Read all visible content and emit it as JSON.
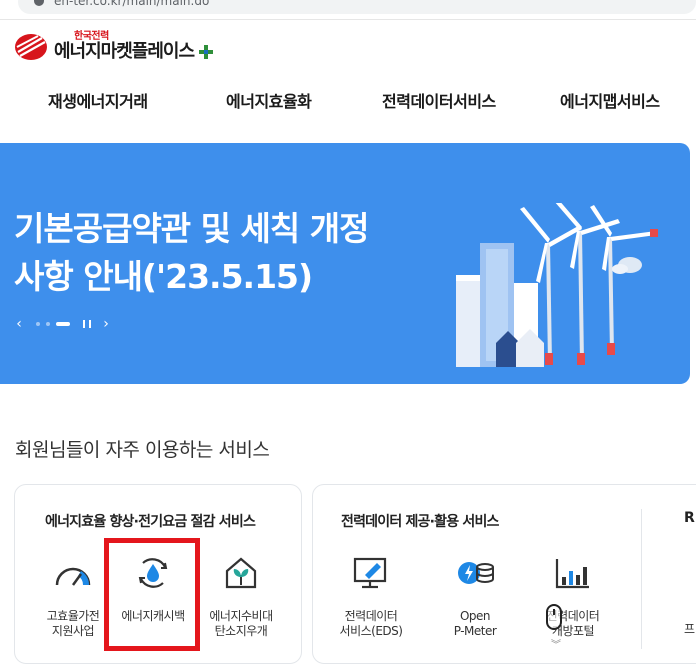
{
  "browser": {
    "url": "en-ter.co.kr/main/main.do"
  },
  "header": {
    "logo_corp": "한국전력",
    "logo_name": "에너지마켓플레이스",
    "brand_red": "#d7151c"
  },
  "nav": {
    "items": [
      {
        "label": "재생에너지거래"
      },
      {
        "label": "에너지효율화"
      },
      {
        "label": "전력데이터서비스"
      },
      {
        "label": "에너지맵서비스"
      }
    ]
  },
  "banner": {
    "title_line1": "기본공급약관 및 세칙 개정",
    "title_line2": "사항 안내('23.5.15)",
    "prev_icon": "chevron-left-icon",
    "next_icon": "chevron-right-icon",
    "background": "#3e8fec"
  },
  "services": {
    "heading": "회원님들이 자주 이용하는 서비스",
    "cards": [
      {
        "title": "에너지효율 향상·전기요금 절감 서비스",
        "items": [
          {
            "label": "고효율가전\n지원사업",
            "icon": "gauge-icon"
          },
          {
            "label": "에너지캐시백",
            "icon": "cashback-drop-icon"
          },
          {
            "label": "에너지수비대\n탄소지우개",
            "icon": "house-leaf-icon"
          }
        ]
      },
      {
        "title": "전력데이터 제공·활용 서비스",
        "items": [
          {
            "label": "전력데이터\n서비스(EDS)",
            "icon": "monitor-pen-icon"
          },
          {
            "label": "Open\nP-Meter",
            "icon": "meter-coin-icon"
          },
          {
            "label": "전력데이터\n개방포털",
            "icon": "bar-chart-icon"
          }
        ],
        "side_heading": "RE",
        "side_item_label": "프"
      }
    ]
  }
}
